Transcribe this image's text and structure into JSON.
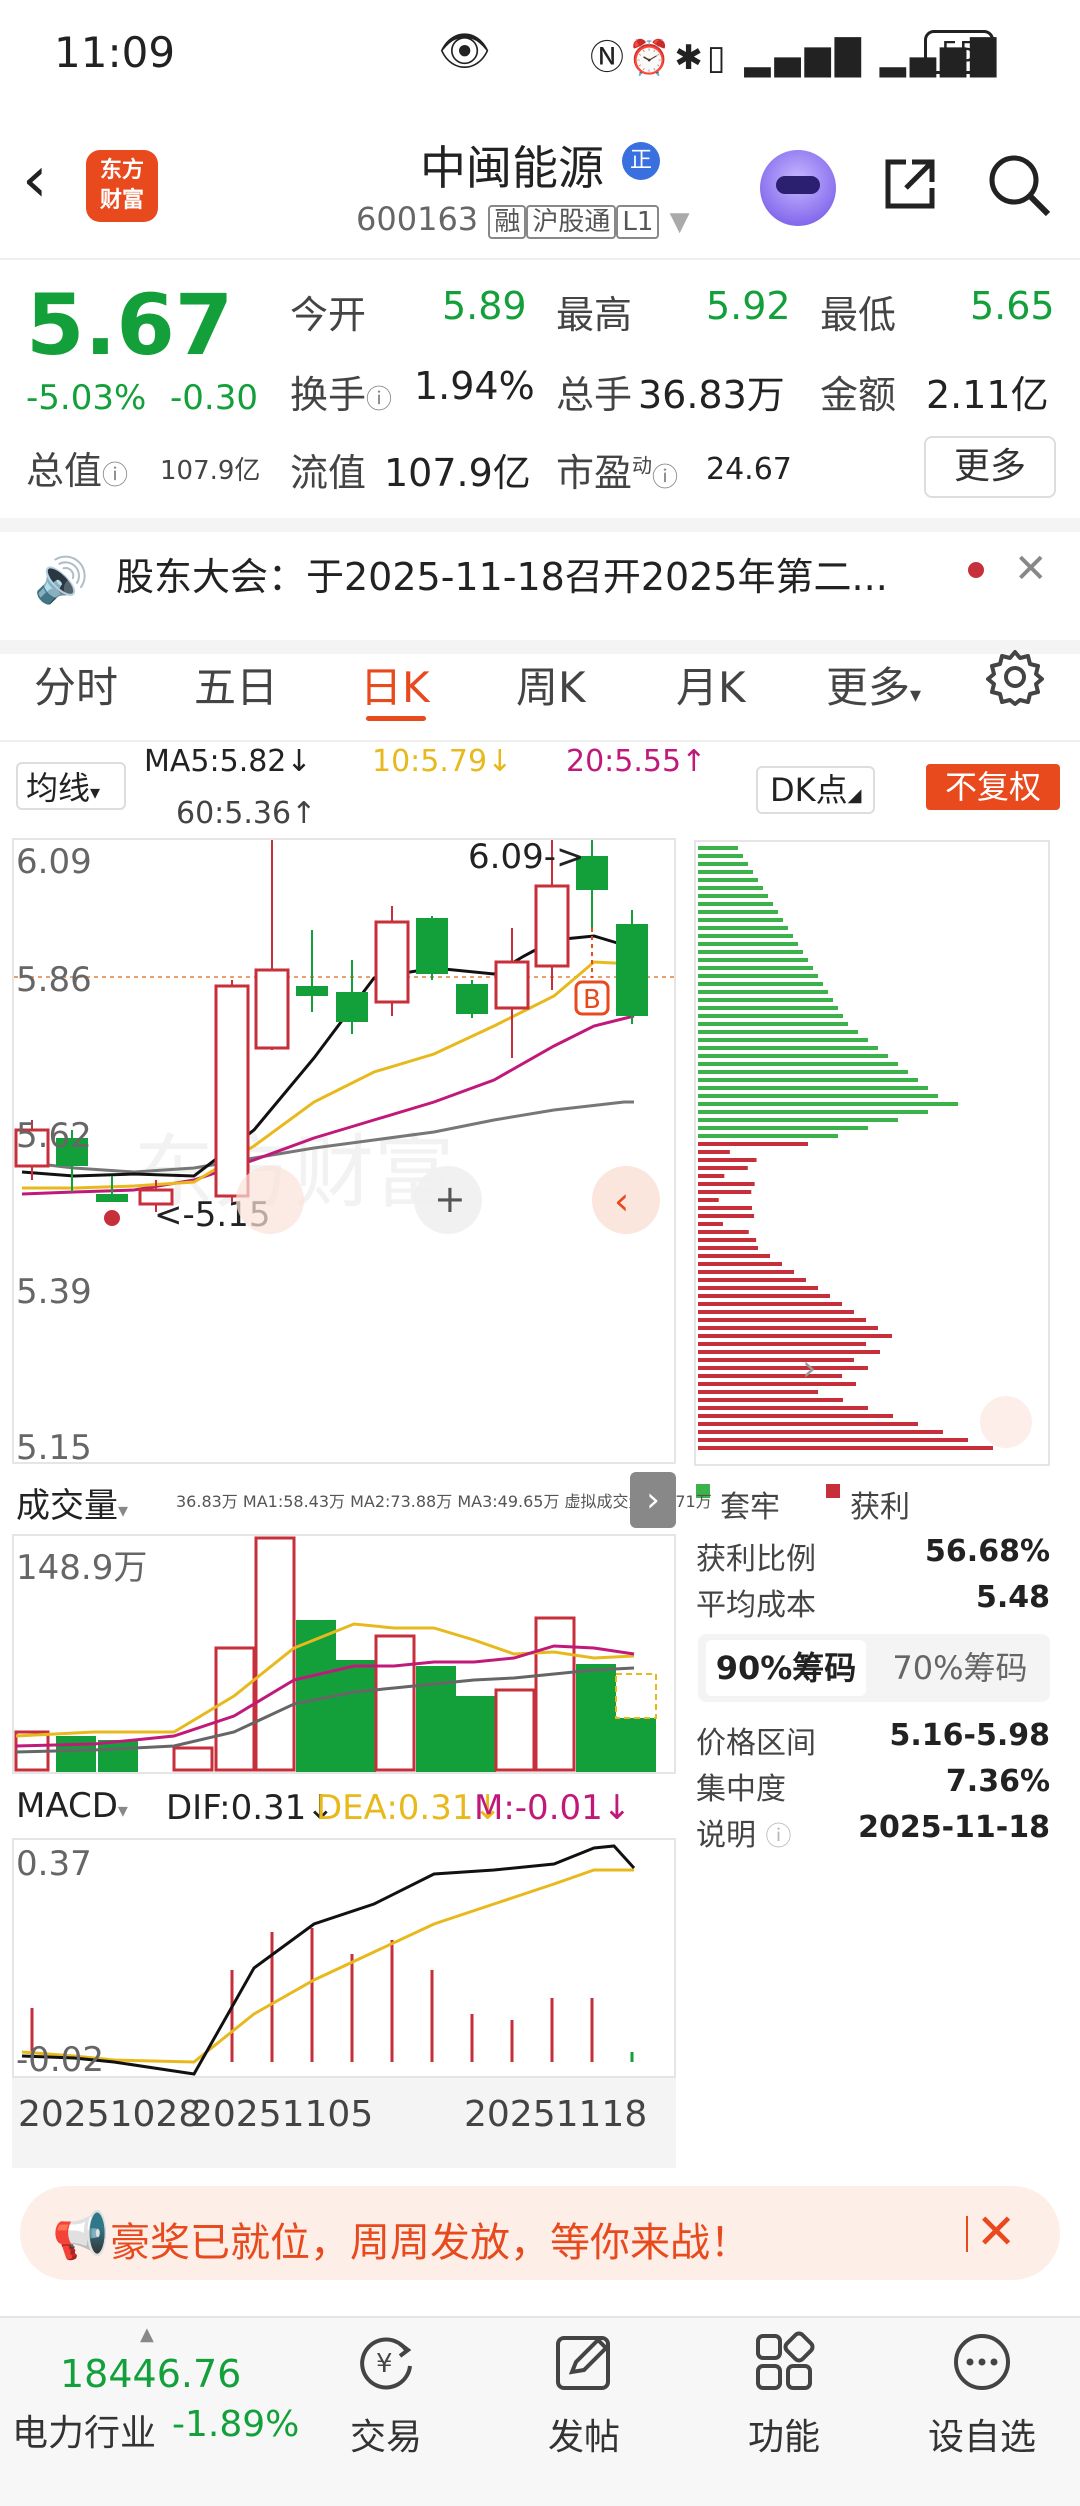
{
  "status_bar": {
    "time": "11:09",
    "battery": "55"
  },
  "header": {
    "logo_line1": "东方",
    "logo_line2": "财富",
    "stock_name": "中闽能源",
    "badge": "正",
    "code": "600163",
    "tag_rong": "融",
    "tag_hgt": "沪股通",
    "tag_l1": "L1"
  },
  "quote": {
    "price": "5.67",
    "change_pct": "-5.03%",
    "change": "-0.30",
    "open_label": "今开",
    "open": "5.89",
    "high_label": "最高",
    "high": "5.92",
    "low_label": "最低",
    "low": "5.65",
    "turnover_label": "换手",
    "turnover": "1.94%",
    "volume_label": "总手",
    "volume": "36.83万",
    "amount_label": "金额",
    "amount": "2.11亿",
    "total_value_label": "总值",
    "total_value": "107.9亿",
    "float_value_label": "流值",
    "float_value": "107.9亿",
    "pe_label": "市盈",
    "pe_sup": "动",
    "pe": "24.67",
    "more": "更多"
  },
  "notice": {
    "text": "股东大会：于2025-11-18召开2025年第二..."
  },
  "tabs": [
    "分时",
    "五日",
    "日K",
    "周K",
    "月K",
    "更多"
  ],
  "ma_legend": {
    "select": "均线",
    "ma5": "MA5:5.82↓",
    "ma10": "10:5.79↓",
    "ma20": "20:5.55↑",
    "ma60": "60:5.36↑",
    "dk": "DK点",
    "fuquan": "不复权"
  },
  "kline": {
    "y_labels": [
      "6.09",
      "5.86",
      "5.62",
      "5.39",
      "5.15"
    ],
    "high_annot": "6.09->",
    "low_annot": "<-5.15",
    "buy_mark": "B"
  },
  "volume": {
    "select": "成交量",
    "legend": "36.83万 MA1:58.43万 MA2:73.88万 MA3:49.65万 虚拟成交量:62.71万",
    "max_label": "148.9万"
  },
  "macd": {
    "select": "MACD",
    "dif": "DIF:0.31↓",
    "dea": "DEA:0.31↓",
    "m": "M:-0.01↓",
    "top_label": "0.37",
    "bottom_label": "-0.02"
  },
  "dates": [
    "20251028",
    "20251105",
    "20251118"
  ],
  "chips": {
    "legend_trapped": "套牢",
    "legend_profit": "获利",
    "profit_ratio_label": "获利比例",
    "profit_ratio": "56.68%",
    "avg_cost_label": "平均成本",
    "avg_cost": "5.48",
    "tab_90": "90%筹码",
    "tab_70": "70%筹码",
    "range_label": "价格区间",
    "range": "5.16-5.98",
    "concentration_label": "集中度",
    "concentration": "7.36%",
    "note_label": "说明",
    "note": "2025-11-18"
  },
  "promo": {
    "text": "豪奖已就位，周周发放，等你来战！"
  },
  "bottom_nav": {
    "index_value": "18446.76",
    "index_name": "电力行业",
    "index_pct": "-1.89%",
    "items": [
      "交易",
      "发帖",
      "功能",
      "设自选"
    ]
  },
  "colors": {
    "up": "#c72f3a",
    "down": "#13a03a",
    "accent": "#e8491d",
    "ma5": "#111111",
    "ma10": "#e8b91c",
    "ma20": "#c0197a",
    "ma60": "#777777"
  }
}
